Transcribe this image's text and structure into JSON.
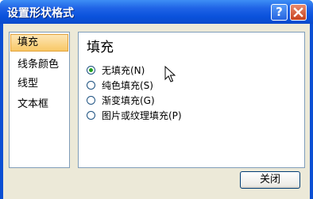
{
  "window": {
    "title": "设置形状格式"
  },
  "sidebar": {
    "items": [
      {
        "label": "填充"
      },
      {
        "label": "线条颜色"
      },
      {
        "label": "线型"
      },
      {
        "label": "文本框"
      }
    ]
  },
  "panel": {
    "heading": "填充",
    "options": [
      {
        "label": "无填充(N)",
        "checked": true
      },
      {
        "label": "纯色填充(S)",
        "checked": false
      },
      {
        "label": "渐变填充(G)",
        "checked": false
      },
      {
        "label": "图片或纹理填充(P)",
        "checked": false
      }
    ]
  },
  "footer": {
    "close_label": "关闭"
  },
  "colors": {
    "titlebar": "#0a52dc",
    "selected_bg": "#f8c867",
    "radio_dot": "#21a121"
  }
}
